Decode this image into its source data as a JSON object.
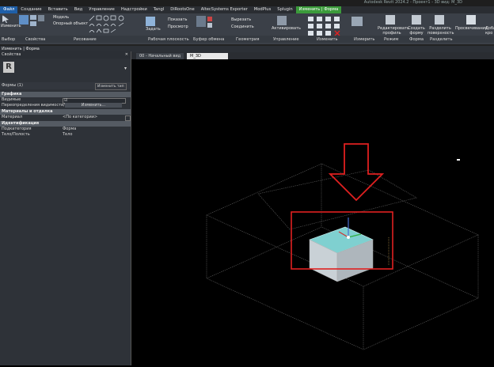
{
  "window": {
    "title": "Autodesk Revit 2024.2 - Проект1 - 3D вид: M_3D"
  },
  "menu": [
    {
      "label": "Файл",
      "kind": "file"
    },
    {
      "label": "Создание"
    },
    {
      "label": "Вставить"
    },
    {
      "label": "Вид"
    },
    {
      "label": "Управление"
    },
    {
      "label": "Надстройки"
    },
    {
      "label": "Tangl"
    },
    {
      "label": "DiRootsOne"
    },
    {
      "label": "AltecSystems Exporter"
    },
    {
      "label": "ModPlus"
    },
    {
      "label": "Splugin"
    },
    {
      "label": "Изменить | Форма",
      "kind": "ctx"
    }
  ],
  "ribbon": {
    "modify_label": "Изменить",
    "model_label": "Модель",
    "ref_obj_label": "Опорный объект",
    "show_label": "Показать",
    "set_label": "Задать",
    "preview_label": "Просмотр",
    "cut_label": "Вырезать",
    "join_label": "Соединить",
    "activate_label": "Активировать",
    "edit_profile_label": "Редактировать профиль",
    "create_form_label": "Создать форму",
    "split_surface_label": "Разделить поверхность",
    "xray_label": "Просвечивание",
    "add_label": "Добав кро",
    "groups": [
      {
        "label": "Выбор"
      },
      {
        "label": "Свойства"
      },
      {
        "label": "Рисование"
      },
      {
        "label": "Рабочая плоскость"
      },
      {
        "label": "Буфер обмена"
      },
      {
        "label": "Геометрия"
      },
      {
        "label": "Управление"
      },
      {
        "label": "Изменить"
      },
      {
        "label": "Измерить"
      },
      {
        "label": "Режим"
      },
      {
        "label": "Форма"
      },
      {
        "label": "Разделить"
      }
    ]
  },
  "options_bar": {
    "text": "Изменить | Форма"
  },
  "properties": {
    "title": "Свойства",
    "type_letter": "R",
    "selector": "Формы (1)",
    "edit_type": "Изменить тип",
    "sections": [
      {
        "name": "Графика",
        "rows": [
          {
            "label": "Видимые",
            "value": "☑"
          },
          {
            "label": "Переопределения видимости/гр...",
            "value": "Изменить..."
          }
        ]
      },
      {
        "name": "Материалы и отделка",
        "rows": [
          {
            "label": "Материал",
            "value": "<По категории>"
          }
        ]
      },
      {
        "name": "Идентификация",
        "rows": [
          {
            "label": "Подкатегория",
            "value": "Форма"
          },
          {
            "label": "Тело/Полость",
            "value": "Тело"
          }
        ]
      }
    ]
  },
  "view_tabs": [
    {
      "label": "00 - Начальный вид"
    },
    {
      "label": "M_3D",
      "active": true
    }
  ],
  "colors": {
    "accent": "#1f5fa8",
    "highlight": "#e02020",
    "solid_top": "#7fd0d0"
  }
}
